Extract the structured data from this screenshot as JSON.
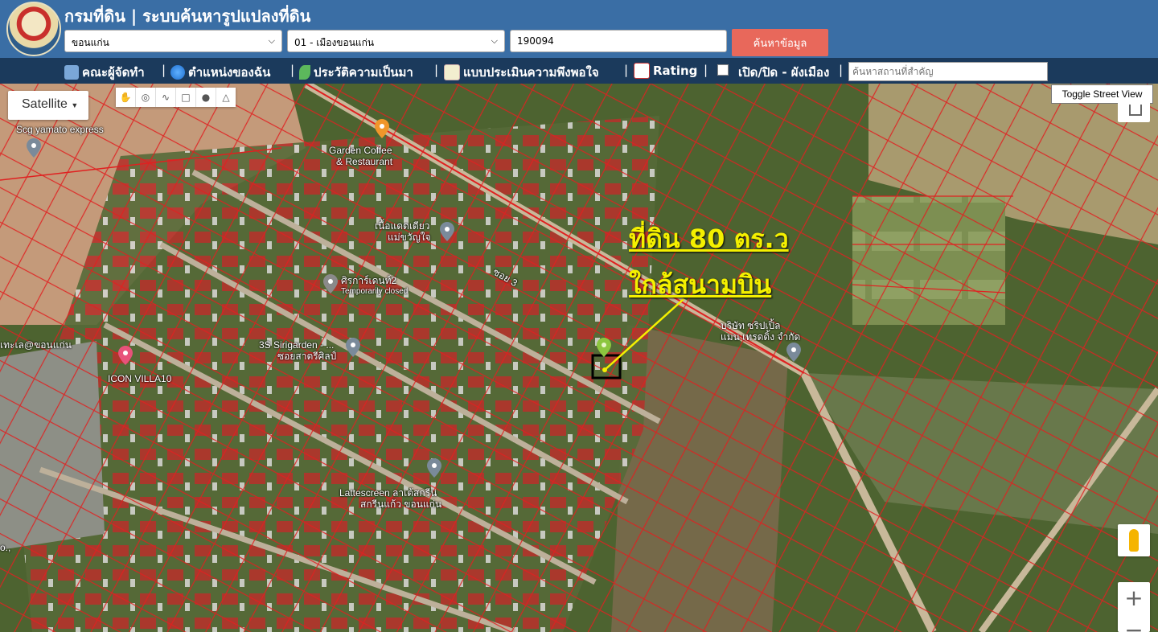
{
  "header": {
    "title": "กรมที่ดิน | ระบบค้นหารูปแปลงที่ดิน",
    "province": "ขอนแก่น",
    "district": "01 - เมืองขอนแก่น",
    "parcel_no": "190094",
    "search_label": "ค้นหาข้อมูล"
  },
  "nav": {
    "items": [
      {
        "label": "คณะผู้จัดทำ",
        "icon": "team-icon"
      },
      {
        "label": "ตำแหน่งของฉัน",
        "icon": "globe-icon"
      },
      {
        "label": "ประวัติความเป็นมา",
        "icon": "sprout-icon"
      },
      {
        "label": "แบบประเมินความพึงพอใจ",
        "icon": "memo-icon"
      },
      {
        "label": "Rating",
        "icon": "chart-icon"
      }
    ],
    "toggle_label": "เปิด/ปิด - ผังเมือง",
    "place_search_placeholder": "ค้นหาสถานที่สำคัญ"
  },
  "map": {
    "maptype_label": "Satellite",
    "street_view_label": "Toggle Street View",
    "zoom_in": "+",
    "zoom_out": "−",
    "annotation": {
      "line1": "ที่ดิน 80 ตร.ว",
      "line2": "ใกล้สนามบิน"
    },
    "labels": [
      {
        "text": "Scg yamato express"
      },
      {
        "text": "Garden Coffee"
      },
      {
        "text": "& Restaurant"
      },
      {
        "text": "เนื้อแดดเดียว"
      },
      {
        "text": "แม่ขวัญใจ"
      },
      {
        "text": "ศิรการ์เดนท์2"
      },
      {
        "text": "Temporarily closed"
      },
      {
        "text": "ซอย 3"
      },
      {
        "text": "3S Sirigarden - ..."
      },
      {
        "text": "ซอยสาตรีศิลป์"
      },
      {
        "text": "เทะเล@ขอนแก่น"
      },
      {
        "text": "ICON VILLA10"
      },
      {
        "text": "บริษัท ซริปเปิ้ล"
      },
      {
        "text": "แมน เทรดดิ้ง จำกัด"
      },
      {
        "text": "Lattescreen ลาเต้สกรีน"
      },
      {
        "text": "สกรีนแก้ว ขอนแก่น"
      },
      {
        "text": "o.,"
      }
    ]
  },
  "colors": {
    "header": "#3a6ea5",
    "nav": "#1b3a5c",
    "search_button": "#e8685b",
    "parcel_line": "#e02020",
    "annotation": "#f4f000"
  }
}
